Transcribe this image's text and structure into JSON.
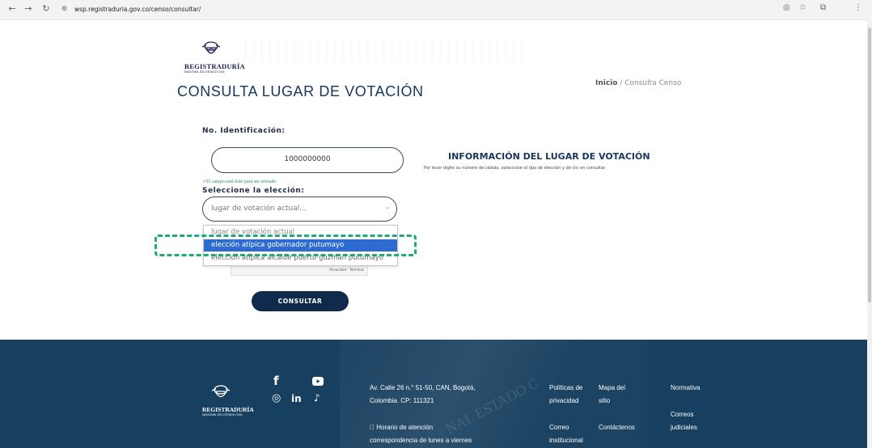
{
  "browser": {
    "url": "wsp.registraduria.gov.co/censo/consultar/"
  },
  "header": {
    "logo_name": "REGISTRADURÍA",
    "logo_sub": "NACIONAL DEL ESTADO CIVIL",
    "title": "CONSULTA LUGAR DE VOTACIÓN",
    "breadcrumb_home": "Inicio",
    "breadcrumb_sep": " / ",
    "breadcrumb_current": "Consulta Censo"
  },
  "form": {
    "id_label": "No. Identificación:",
    "id_value": "1000000000",
    "valid_msg": "✓El campo está listo para ser enviado",
    "election_label": "Seleccione la elección:",
    "election_value": "lugar de votación actual...",
    "options": [
      "lugar de votación actual",
      "elección atípica gobernador putumayo",
      "elección atípica alcalde puerto guzmán putumayo"
    ],
    "captcha_links": "Privacidad - Términos",
    "submit_label": "CONSULTAR"
  },
  "info": {
    "title": "INFORMACIÓN DEL LUGAR DE VOTACIÓN",
    "text": "Por favor digite su número de cédula, seleccione el tipo de elección y dé clic en consultar."
  },
  "footer": {
    "logo_name": "REGISTRADURÍA",
    "logo_sub": "NACIONAL DEL ESTADO CIVIL",
    "address_1": "Av. Calle 26 n.° 51-50, CAN, Bogotá,",
    "address_2": "Colombia. CP: 111321",
    "hours_1": "\u0000 Horario de atención",
    "hours_2": "correspondencia de lunes a viernes",
    "links": {
      "privacy_1": "Políticas de",
      "privacy_2": "privacidad",
      "map_1": "Mapa del",
      "map_2": "sitio",
      "norm": "Normativa",
      "judicial_1": "Correos",
      "judicial_2": "judiciales",
      "inst_1": "Correo",
      "inst_2": "institucional",
      "contact": "Contáctenos"
    },
    "social": {
      "facebook": "f",
      "instagram": "◎",
      "linkedin": "in",
      "tiktok": "♪"
    }
  },
  "colors": {
    "brand_navy": "#17375e",
    "button": "#0f2a4a",
    "footer": "#173f5f",
    "selected_option": "#2e6bd1",
    "highlight": "#1faa7a"
  }
}
